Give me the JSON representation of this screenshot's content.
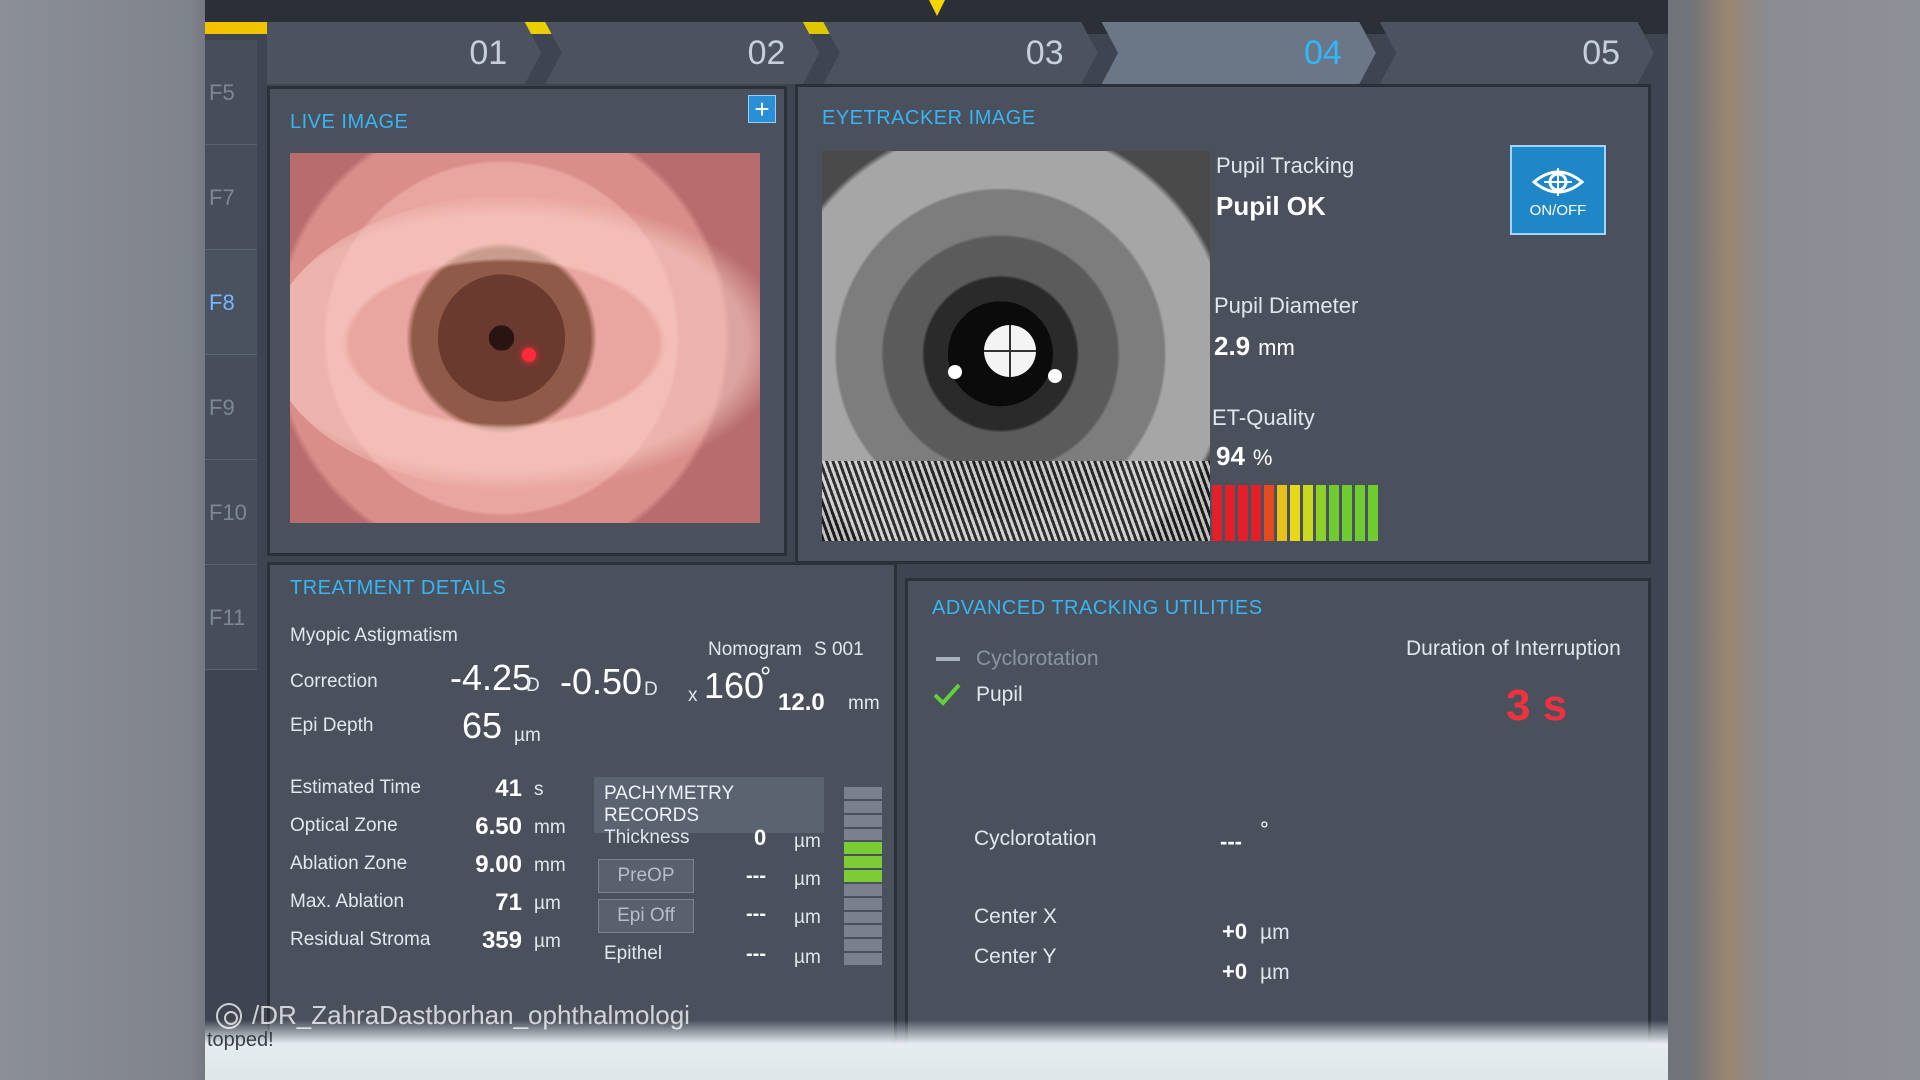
{
  "progress": {
    "fraction": 0.5
  },
  "fkeys": [
    "F5",
    "F7",
    "F8",
    "F9",
    "F10",
    "F11"
  ],
  "steps": [
    "01",
    "02",
    "03",
    "04",
    "05"
  ],
  "live_image": {
    "title": "LIVE IMAGE"
  },
  "eyetracker": {
    "title": "EYETRACKER IMAGE",
    "pupil_tracking_label": "Pupil Tracking",
    "pupil_status": "Pupil OK",
    "onoff_label": "ON/OFF",
    "pupil_diameter_label": "Pupil Diameter",
    "pupil_diameter_value": "2.9",
    "pupil_diameter_unit": "mm",
    "et_quality_label": "ET-Quality",
    "et_quality_value": "94",
    "et_quality_unit": "%",
    "quality_colors": [
      "#e3202a",
      "#e3202a",
      "#e3202a",
      "#e3202a",
      "#e34a20",
      "#e8c21c",
      "#e8d81c",
      "#c9d81c",
      "#8cd02a",
      "#6fcc30",
      "#6fcc30",
      "#6fcc30",
      "#6fcc30"
    ]
  },
  "treatment": {
    "title": "TREATMENT DETAILS",
    "type": "Myopic Astigmatism",
    "nomogram_label": "Nomogram",
    "nomogram_value": "S 001",
    "correction_label": "Correction",
    "sphere": "-4.25",
    "sphere_unit": "D",
    "cylinder": "-0.50",
    "cylinder_unit": "D",
    "axis_prefix": "x",
    "axis": "160",
    "axis_unit": "°",
    "zone": "12.0",
    "zone_unit": "mm",
    "epi_depth_label": "Epi Depth",
    "epi_depth": "65",
    "epi_depth_unit": "µm",
    "rows": [
      {
        "label": "Estimated Time",
        "value": "41",
        "unit": "s"
      },
      {
        "label": "Optical Zone",
        "value": "6.50",
        "unit": "mm"
      },
      {
        "label": "Ablation Zone",
        "value": "9.00",
        "unit": "mm"
      },
      {
        "label": "Max. Ablation",
        "value": "71",
        "unit": "µm"
      },
      {
        "label": "Residual Stroma",
        "value": "359",
        "unit": "µm"
      }
    ],
    "pachymetry": {
      "title": "PACHYMETRY RECORDS",
      "thickness_label": "Thickness",
      "thickness_value": "0",
      "preop_button": "PreOP",
      "preop_value": "---",
      "epioff_button": "Epi Off",
      "epioff_value": "---",
      "epithel_label": "Epithel",
      "epithel_value": "---",
      "unit": "µm"
    }
  },
  "tracking": {
    "title": "ADVANCED TRACKING UTILITIES",
    "cyclorotation_toggle": "Cyclorotation",
    "pupil_toggle": "Pupil",
    "interruption_label": "Duration of Interruption",
    "interruption_value": "3 s",
    "cyclorotation_label": "Cyclorotation",
    "cyclorotation_value": "---",
    "cyclorotation_unit": "°",
    "center_x_label": "Center X",
    "center_x_value": "+0",
    "center_y_label": "Center Y",
    "center_y_value": "+0",
    "center_unit": "µm"
  },
  "status": {
    "message": "topped!"
  },
  "watermark": "/DR_ZahraDastborhan_ophthalmologi"
}
